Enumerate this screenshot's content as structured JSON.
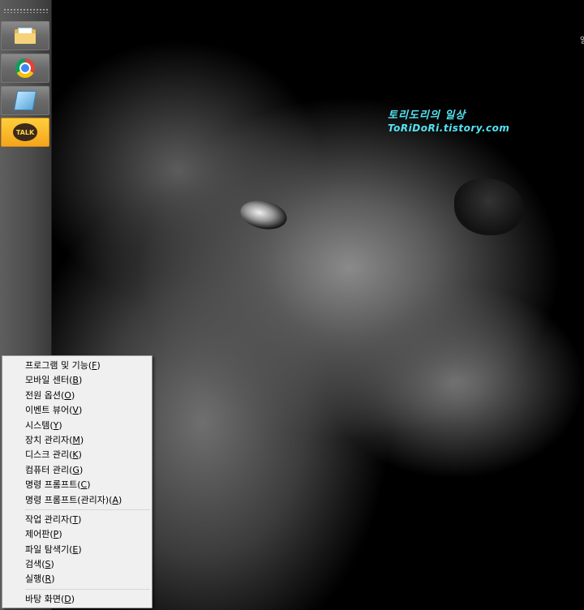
{
  "desktop": {
    "blog_title": "토리도리의 일상",
    "blog_url": "ToRiDoRi.tistory.com",
    "edge_text": "일"
  },
  "taskbar": {
    "buttons": [
      {
        "name": "explorer",
        "icon": "folder-icon"
      },
      {
        "name": "chrome",
        "icon": "chrome-icon"
      },
      {
        "name": "notes",
        "icon": "notes-icon"
      },
      {
        "name": "kakaotalk",
        "icon": "talk-icon",
        "label": "TALK"
      }
    ]
  },
  "menu": {
    "groups": [
      [
        {
          "label": "프로그램 및 기능",
          "key": "F"
        },
        {
          "label": "모바일 센터",
          "key": "B"
        },
        {
          "label": "전원 옵션",
          "key": "O"
        },
        {
          "label": "이벤트 뷰어",
          "key": "V"
        },
        {
          "label": "시스템",
          "key": "Y"
        },
        {
          "label": "장치 관리자",
          "key": "M"
        },
        {
          "label": "디스크 관리",
          "key": "K"
        },
        {
          "label": "컴퓨터 관리",
          "key": "G"
        },
        {
          "label": "명령 프롬프트",
          "key": "C"
        },
        {
          "label": "명령 프롬프트(관리자)",
          "key": "A"
        }
      ],
      [
        {
          "label": "작업 관리자",
          "key": "T"
        },
        {
          "label": "제어판",
          "key": "P"
        },
        {
          "label": "파일 탐색기",
          "key": "E"
        },
        {
          "label": "검색",
          "key": "S"
        },
        {
          "label": "실행",
          "key": "R"
        }
      ],
      [
        {
          "label": "바탕 화면",
          "key": "D"
        }
      ]
    ]
  }
}
